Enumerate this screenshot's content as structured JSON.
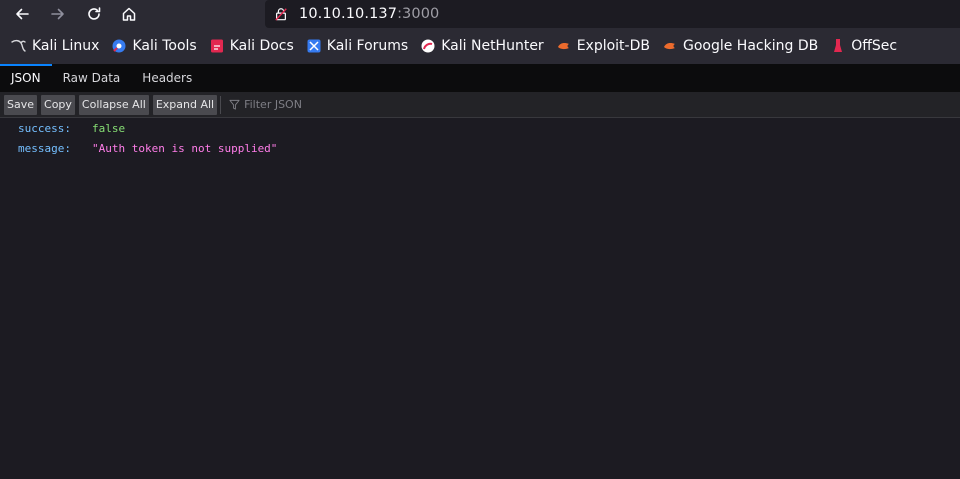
{
  "browser": {
    "url_host": "10.10.10.137",
    "url_port": ":3000",
    "nav_icons": [
      "back-arrow-icon",
      "forward-arrow-icon",
      "reload-icon",
      "home-icon"
    ]
  },
  "bookmarks": [
    {
      "label": "Kali Linux",
      "icon": "kali-dragon-icon"
    },
    {
      "label": "Kali Tools",
      "icon": "kali-tools-icon"
    },
    {
      "label": "Kali Docs",
      "icon": "kali-docs-icon"
    },
    {
      "label": "Kali Forums",
      "icon": "kali-forums-icon"
    },
    {
      "label": "Kali NetHunter",
      "icon": "nethunter-icon"
    },
    {
      "label": "Exploit-DB",
      "icon": "exploit-db-icon"
    },
    {
      "label": "Google Hacking DB",
      "icon": "ghdb-icon"
    },
    {
      "label": "OffSec",
      "icon": "offsec-icon"
    }
  ],
  "viewer": {
    "tabs": [
      "JSON",
      "Raw Data",
      "Headers"
    ],
    "active_tab": "JSON",
    "toolbar": {
      "save": "Save",
      "copy": "Copy",
      "collapse_all": "Collapse All",
      "expand_all": "Expand All",
      "filter_placeholder": "Filter JSON"
    },
    "rows": [
      {
        "key": "success:",
        "value": "false",
        "type": "boolean"
      },
      {
        "key": "message:",
        "value": "\"Auth token is not supplied\"",
        "type": "string"
      }
    ]
  },
  "colors": {
    "accent": "#0a84ff",
    "key": "#75bfff",
    "boolean": "#86de74",
    "string": "#ff7de9"
  }
}
